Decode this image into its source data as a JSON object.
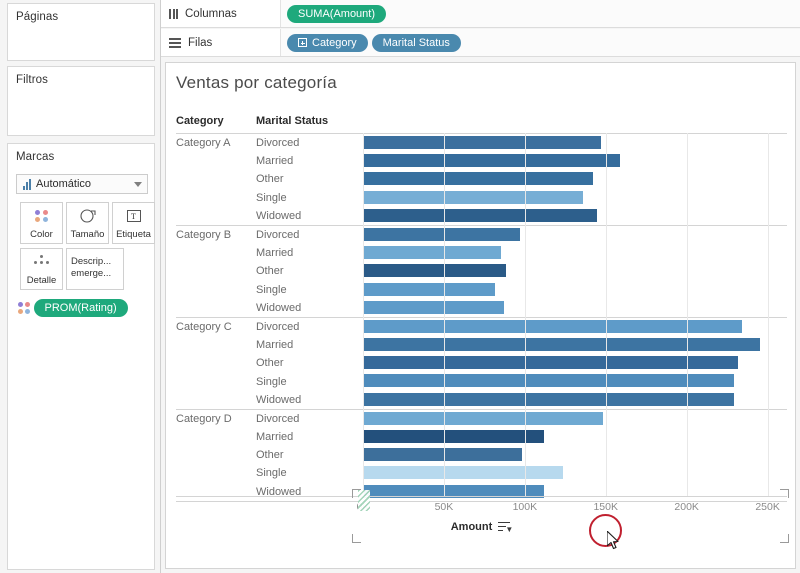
{
  "left_panel": {
    "pages": {
      "title": "Páginas"
    },
    "filters": {
      "title": "Filtros"
    },
    "marks": {
      "title": "Marcas",
      "mark_type": "Automático",
      "buttons": [
        {
          "id": "color",
          "label": "Color",
          "icon": "color-dots-icon"
        },
        {
          "id": "size",
          "label": "Tamaño",
          "icon": "size-circle-icon"
        },
        {
          "id": "label",
          "label": "Etiqueta",
          "icon": "text-label-icon"
        },
        {
          "id": "detail",
          "label": "Detalle",
          "icon": "detail-dots-icon"
        },
        {
          "id": "tooltip",
          "label": "Descrip... emerge...",
          "icon": "tooltip-icon"
        }
      ],
      "color_pill": "PROM(Rating)"
    }
  },
  "shelves": {
    "columns": {
      "label": "Columnas",
      "icon": "columns-icon",
      "pills": [
        {
          "text": "SUMA(Amount)",
          "color": "#1ea97c",
          "type": "measure"
        }
      ]
    },
    "rows": {
      "label": "Filas",
      "icon": "rows-icon",
      "pills": [
        {
          "text": "Category",
          "color": "#4a89ae",
          "type": "dimension",
          "expandable": true
        },
        {
          "text": "Marital Status",
          "color": "#4a89ae",
          "type": "dimension",
          "expandable": false
        }
      ]
    }
  },
  "sheet": {
    "title": "Ventas por categoría",
    "headers": {
      "category": "Category",
      "marital_status": "Marital Status"
    },
    "axis_title": "Amount",
    "sort_icon": "sort-descending-icon",
    "highlight_color": "#c0202f"
  },
  "chart_data": {
    "type": "bar",
    "title": "Ventas por categoría",
    "xlabel": "Amount",
    "ylabel": "",
    "orientation": "horizontal",
    "xlim": [
      0,
      262000
    ],
    "ticks": [
      "0K",
      "50K",
      "100K",
      "150K",
      "200K",
      "250K"
    ],
    "tick_values": [
      0,
      50000,
      100000,
      150000,
      200000,
      250000
    ],
    "grid": true,
    "legend": null,
    "color_encoding": "PROM(Rating)",
    "groups": [
      {
        "category": "Category A",
        "rows": [
          {
            "label": "Divorced",
            "value": 147000,
            "color": "#3b6f9e"
          },
          {
            "label": "Married",
            "value": 158500,
            "color": "#356c9c"
          },
          {
            "label": "Other",
            "value": 142000,
            "color": "#37709f"
          },
          {
            "label": "Single",
            "value": 136000,
            "color": "#77aed5"
          },
          {
            "label": "Widowed",
            "value": 144500,
            "color": "#2d5f8c"
          }
        ]
      },
      {
        "category": "Category B",
        "rows": [
          {
            "label": "Divorced",
            "value": 97000,
            "color": "#3d74a2"
          },
          {
            "label": "Married",
            "value": 85500,
            "color": "#6fa9d2"
          },
          {
            "label": "Other",
            "value": 88500,
            "color": "#2a5a87"
          },
          {
            "label": "Single",
            "value": 81500,
            "color": "#5e9bc9"
          },
          {
            "label": "Widowed",
            "value": 87000,
            "color": "#5e9bc9"
          }
        ]
      },
      {
        "category": "Category C",
        "rows": [
          {
            "label": "Divorced",
            "value": 234000,
            "color": "#5e9bc9"
          },
          {
            "label": "Married",
            "value": 245500,
            "color": "#3d74a2"
          },
          {
            "label": "Other",
            "value": 231500,
            "color": "#35699a"
          },
          {
            "label": "Single",
            "value": 229000,
            "color": "#4f8cbc"
          },
          {
            "label": "Widowed",
            "value": 229500,
            "color": "#3d74a2"
          }
        ]
      },
      {
        "category": "Category D",
        "rows": [
          {
            "label": "Divorced",
            "value": 148000,
            "color": "#6fa9d2"
          },
          {
            "label": "Married",
            "value": 112000,
            "color": "#23507c"
          },
          {
            "label": "Other",
            "value": 98000,
            "color": "#3d6f9b"
          },
          {
            "label": "Single",
            "value": 123500,
            "color": "#b7d9ee"
          },
          {
            "label": "Widowed",
            "value": 112000,
            "color": "#4f8cbc"
          }
        ]
      }
    ]
  }
}
